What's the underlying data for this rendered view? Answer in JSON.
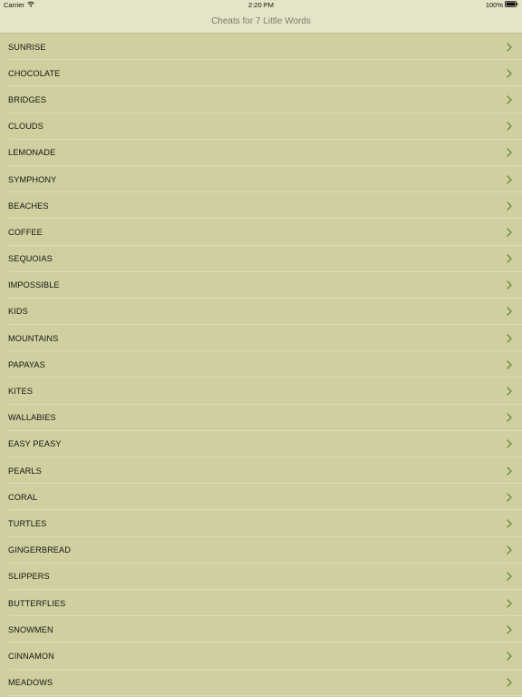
{
  "status_bar": {
    "carrier": "Carrier",
    "time": "2:20 PM",
    "battery": "100%"
  },
  "nav": {
    "title": "Cheats for 7 Little Words"
  },
  "list": {
    "items": [
      "SUNRISE",
      "CHOCOLATE",
      "BRIDGES",
      "CLOUDS",
      "LEMONADE",
      "SYMPHONY",
      "BEACHES",
      "COFFEE",
      "SEQUOIAS",
      "IMPOSSIBLE",
      "KIDS",
      "MOUNTAINS",
      "PAPAYAS",
      "KITES",
      "WALLABIES",
      "EASY PEASY",
      "PEARLS",
      "CORAL",
      "TURTLES",
      "GINGERBREAD",
      "SLIPPERS",
      "BUTTERFLIES",
      "SNOWMEN",
      "CINNAMON",
      "MEADOWS"
    ]
  },
  "icons": {
    "wifi": "wifi-icon",
    "battery": "battery-icon",
    "disclosure": "chevron-right-icon"
  },
  "colors": {
    "background": "#cdcd9d",
    "nav_background": "#e4e4c6",
    "chevron": "#6c8a3c",
    "text": "#161616"
  }
}
